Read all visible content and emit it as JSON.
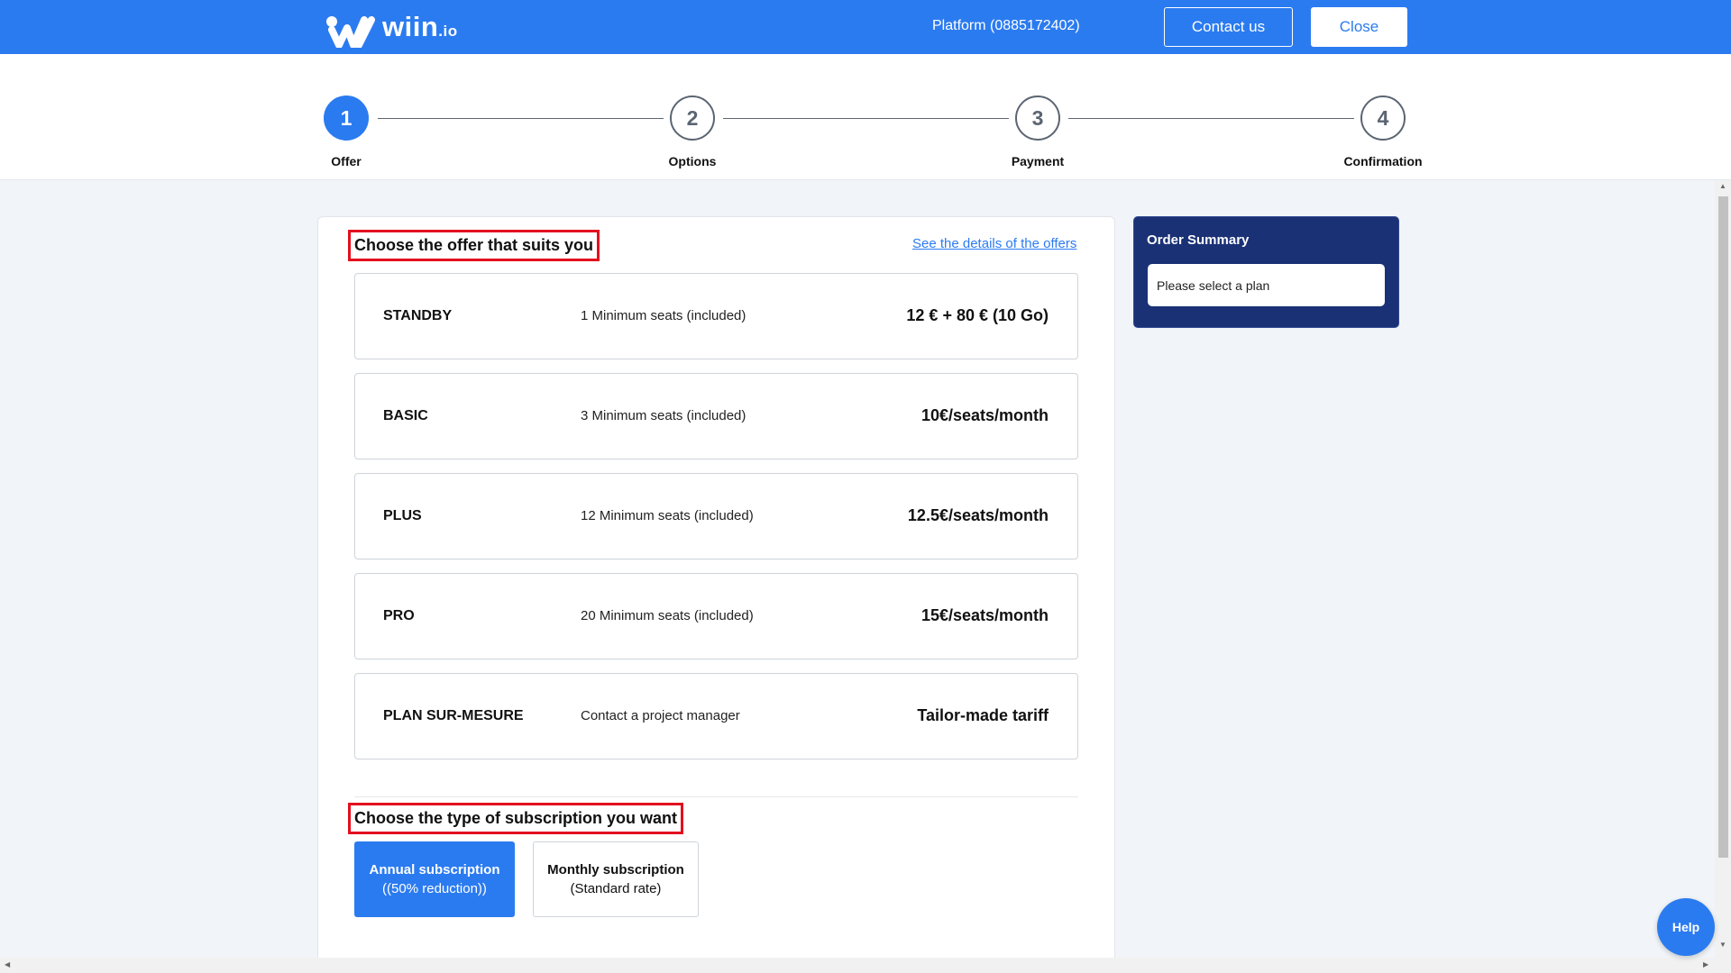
{
  "header": {
    "brand": "wiin",
    "brand_suffix": ".io",
    "platform": "Platform (0885172402)",
    "contact_label": "Contact us",
    "close_label": "Close"
  },
  "stepper": {
    "steps": [
      {
        "number": "1",
        "label": "Offer",
        "active": true
      },
      {
        "number": "2",
        "label": "Options",
        "active": false
      },
      {
        "number": "3",
        "label": "Payment",
        "active": false
      },
      {
        "number": "4",
        "label": "Confirmation",
        "active": false
      }
    ]
  },
  "offers": {
    "title": "Choose the offer that suits you",
    "details_link": "See the details of the offers",
    "plans": [
      {
        "name": "STANDBY",
        "seats": "1 Minimum seats (included)",
        "price": "12 € + 80 € (10 Go)"
      },
      {
        "name": "BASIC",
        "seats": "3 Minimum seats (included)",
        "price": "10€/seats/month"
      },
      {
        "name": "PLUS",
        "seats": "12 Minimum seats (included)",
        "price": "12.5€/seats/month"
      },
      {
        "name": "PRO",
        "seats": "20 Minimum seats (included)",
        "price": "15€/seats/month"
      },
      {
        "name": "PLAN SUR-MESURE",
        "seats": "Contact a project manager",
        "price": "Tailor-made tariff"
      }
    ]
  },
  "subscription": {
    "title": "Choose the type of subscription you want",
    "annual": {
      "label": "Annual subscription",
      "note": "((50% reduction))",
      "selected": true
    },
    "monthly": {
      "label": "Monthly subscription",
      "note": "(Standard rate)",
      "selected": false
    }
  },
  "summary": {
    "title": "Order Summary",
    "placeholder": "Please select a plan"
  },
  "help_label": "Help",
  "colors": {
    "primary": "#2b7bf0",
    "summary_bg": "#1a3175",
    "highlight_border": "#e3101f"
  }
}
